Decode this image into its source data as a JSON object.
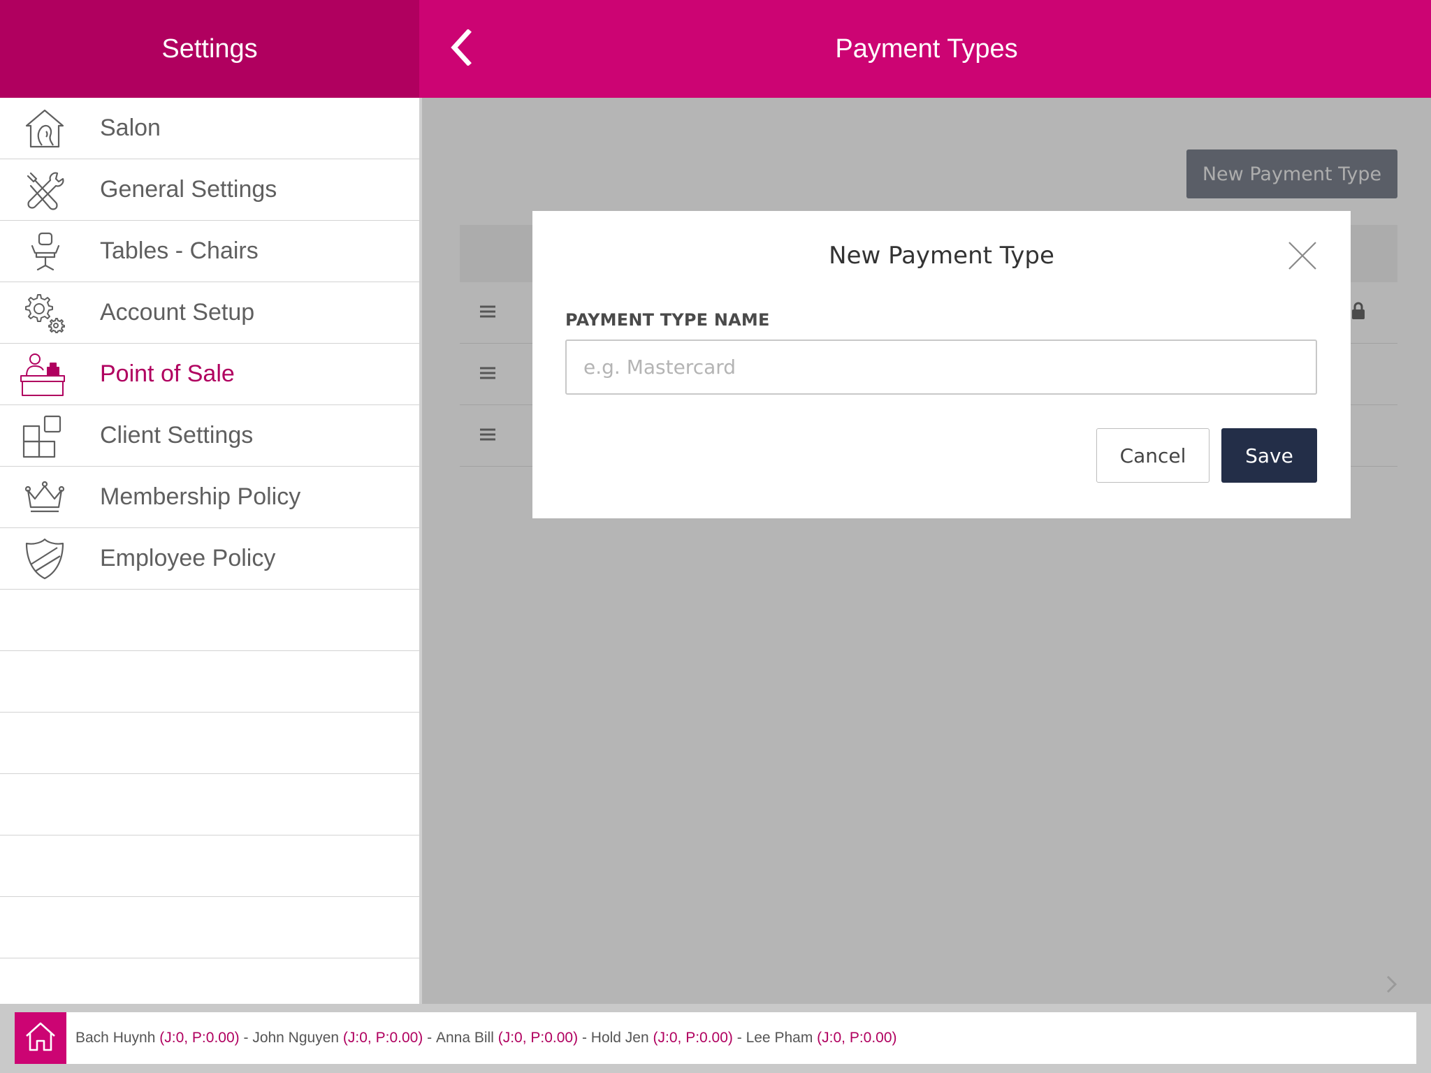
{
  "sidebar": {
    "title": "Settings",
    "items": [
      {
        "label": "Salon",
        "icon": "house-face-icon"
      },
      {
        "label": "General Settings",
        "icon": "tools-icon"
      },
      {
        "label": "Tables - Chairs",
        "icon": "salon-chair-icon"
      },
      {
        "label": "Account Setup",
        "icon": "gears-icon"
      },
      {
        "label": "Point of Sale",
        "icon": "cashier-icon"
      },
      {
        "label": "Client Settings",
        "icon": "grid-icon"
      },
      {
        "label": "Membership Policy",
        "icon": "crown-icon"
      },
      {
        "label": "Employee Policy",
        "icon": "shield-icon"
      }
    ],
    "active_index": 4,
    "empty_rows": 7
  },
  "header": {
    "title": "Payment Types",
    "back_icon": "chevron-left-icon"
  },
  "main": {
    "new_button_label": "New Payment Type",
    "row_count": 3
  },
  "modal": {
    "title": "New Payment Type",
    "field_label": "PAYMENT TYPE NAME",
    "input_value": "",
    "input_placeholder": "e.g. Mastercard",
    "cancel_label": "Cancel",
    "save_label": "Save"
  },
  "footer": {
    "staff": [
      {
        "name": "Bach Huynh",
        "stats": "(J:0, P:0.00)"
      },
      {
        "name": "John Nguyen",
        "stats": "(J:0, P:0.00)"
      },
      {
        "name": "Anna Bill",
        "stats": "(J:0, P:0.00)"
      },
      {
        "name": "Hold Jen",
        "stats": "(J:0, P:0.00)"
      },
      {
        "name": "Lee Pham",
        "stats": "(J:0, P:0.00)"
      }
    ],
    "separator": " - "
  },
  "colors": {
    "brand_dark": "#b0005f",
    "brand": "#cc0473",
    "save_button": "#232e48"
  }
}
